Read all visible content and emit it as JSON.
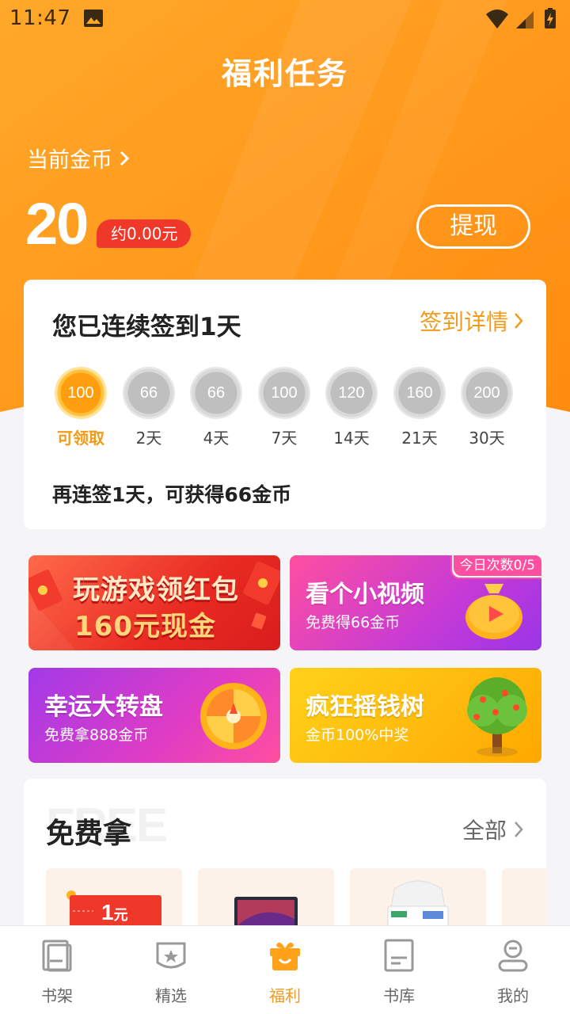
{
  "status_bar": {
    "time": "11:47"
  },
  "header": {
    "title": "福利任务",
    "coins_label": "当前金币",
    "coins_value": "20",
    "yuan_equiv": "约0.00元",
    "withdraw_label": "提现",
    "accent_color": "#ff9b1c"
  },
  "checkin": {
    "title": "您已连续签到1天",
    "detail_link": "签到详情",
    "days": [
      {
        "coins": "100",
        "label": "可领取",
        "active": true
      },
      {
        "coins": "66",
        "label": "2天",
        "active": false
      },
      {
        "coins": "66",
        "label": "4天",
        "active": false
      },
      {
        "coins": "100",
        "label": "7天",
        "active": false
      },
      {
        "coins": "120",
        "label": "14天",
        "active": false
      },
      {
        "coins": "160",
        "label": "21天",
        "active": false
      },
      {
        "coins": "200",
        "label": "30天",
        "active": false
      }
    ],
    "note": "再连签1天，可获得66金币"
  },
  "banners": {
    "game": {
      "title": "玩游戏领红包",
      "subtitle": "160元现金"
    },
    "video": {
      "title": "看个小视频",
      "subtitle": "免费得66金币",
      "badge": "今日次数0/5"
    },
    "wheel": {
      "title": "幸运大转盘",
      "subtitle": "免费拿888金币"
    },
    "tree": {
      "title": "疯狂摇钱树",
      "subtitle": "金币100%中奖"
    }
  },
  "free_section": {
    "watermark": "FREE",
    "title": "免费拿",
    "all_link": "全部",
    "coupon_value": "1",
    "coupon_unit": "元"
  },
  "bottom_nav": {
    "items": [
      {
        "label": "书架",
        "icon": "bookshelf-icon"
      },
      {
        "label": "精选",
        "icon": "featured-icon"
      },
      {
        "label": "福利",
        "icon": "gift-icon",
        "active": true
      },
      {
        "label": "书库",
        "icon": "library-icon"
      },
      {
        "label": "我的",
        "icon": "profile-icon"
      }
    ]
  }
}
